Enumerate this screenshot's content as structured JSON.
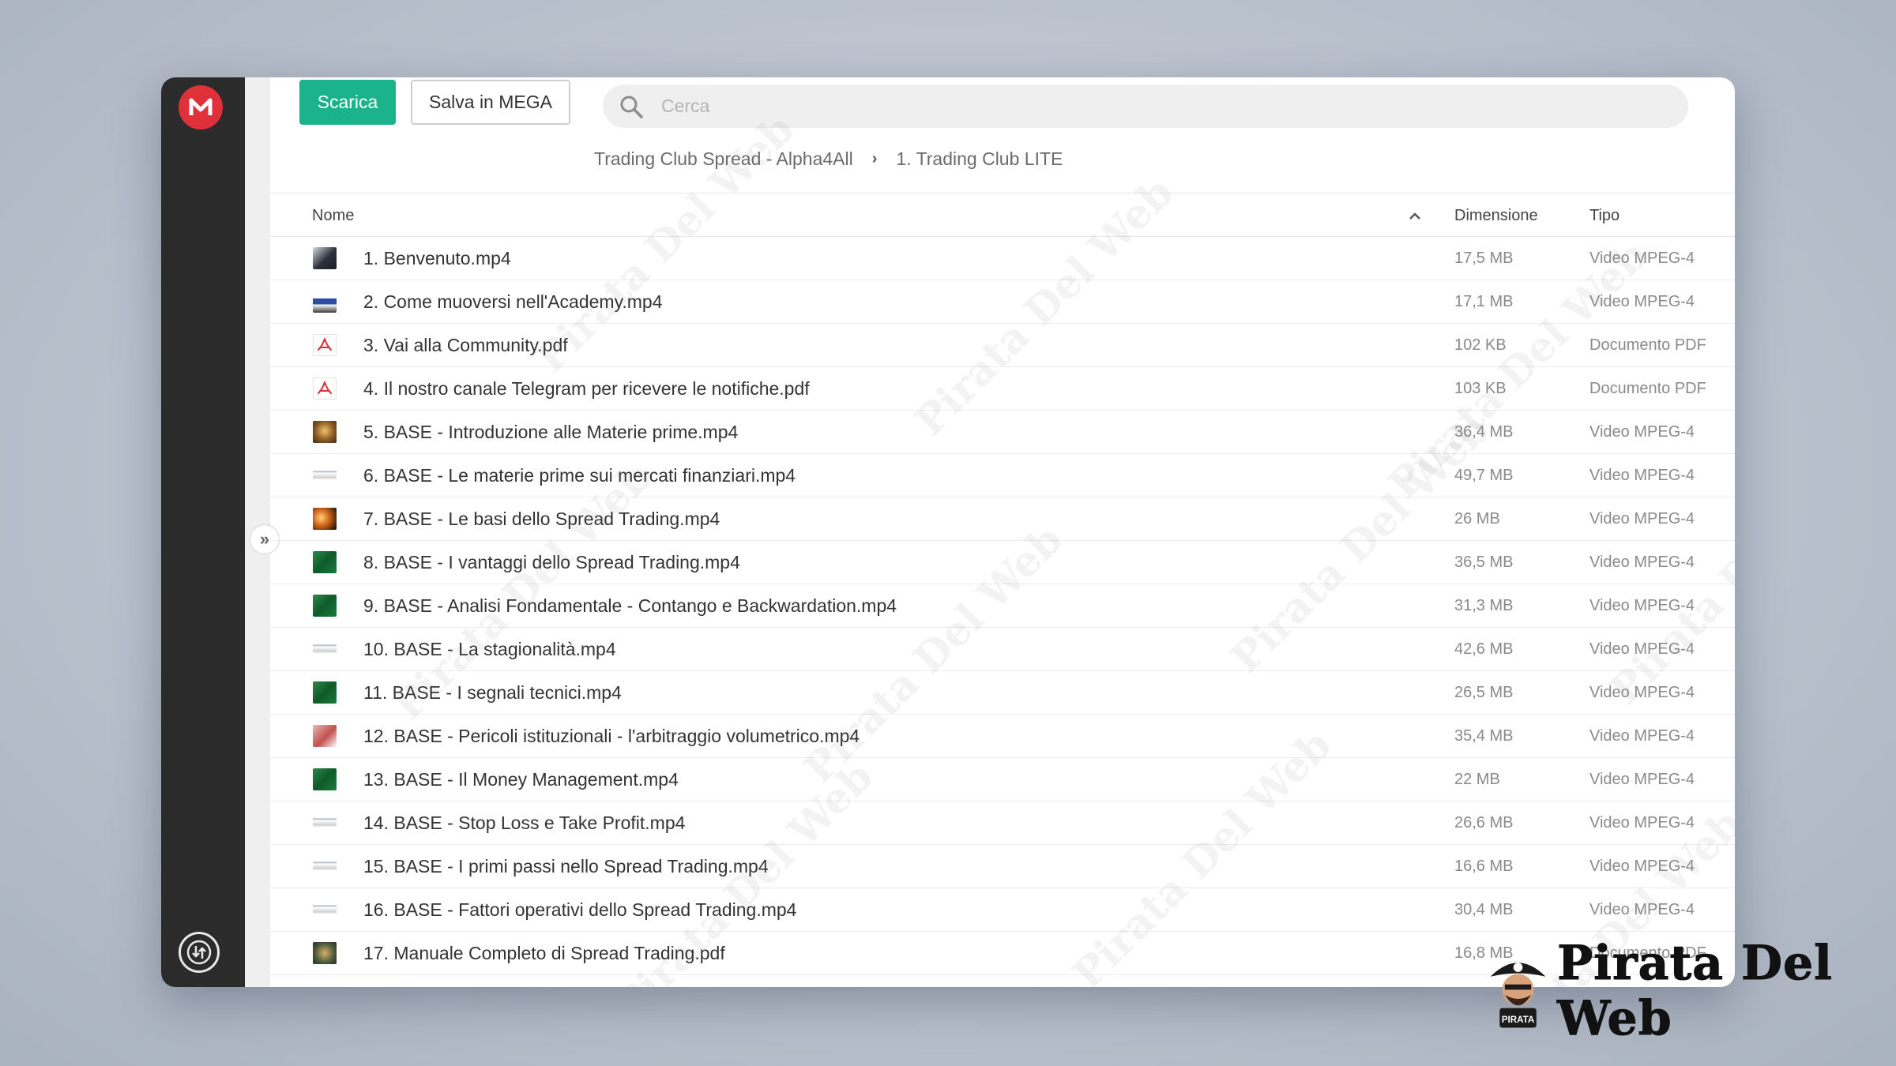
{
  "toolbar": {
    "download_label": "Scarica",
    "save_label": "Salva in MEGA"
  },
  "search": {
    "placeholder": "Cerca",
    "value": ""
  },
  "breadcrumb": {
    "items": [
      "Trading Club Spread - Alpha4All",
      "1. Trading Club LITE"
    ]
  },
  "table": {
    "columns": {
      "name": "Nome",
      "size": "Dimensione",
      "type": "Tipo"
    },
    "sort": "ascending",
    "rows": [
      {
        "name": "1. Benvenuto.mp4",
        "size": "17,5 MB",
        "type": "Video MPEG-4",
        "thumb": "video-person"
      },
      {
        "name": "2. Come muoversi nell'Academy.mp4",
        "size": "17,1 MB",
        "type": "Video MPEG-4",
        "thumb": "video-screen"
      },
      {
        "name": "3. Vai alla Community.pdf",
        "size": "102 KB",
        "type": "Documento PDF",
        "thumb": "pdf"
      },
      {
        "name": "4. Il nostro canale Telegram per ricevere le notifiche.pdf",
        "size": "103 KB",
        "type": "Documento PDF",
        "thumb": "pdf"
      },
      {
        "name": "5. BASE - Introduzione alle Materie prime.mp4",
        "size": "36,4 MB",
        "type": "Video MPEG-4",
        "thumb": "video-gold"
      },
      {
        "name": "6. BASE - Le materie prime sui mercati finanziari.mp4",
        "size": "49,7 MB",
        "type": "Video MPEG-4",
        "thumb": "video-light"
      },
      {
        "name": "7. BASE - Le basi dello Spread Trading.mp4",
        "size": "26 MB",
        "type": "Video MPEG-4",
        "thumb": "video-fire"
      },
      {
        "name": "8. BASE - I vantaggi dello Spread Trading.mp4",
        "size": "36,5 MB",
        "type": "Video MPEG-4",
        "thumb": "video-green"
      },
      {
        "name": "9. BASE - Analisi Fondamentale - Contango e Backwardation.mp4",
        "size": "31,3 MB",
        "type": "Video MPEG-4",
        "thumb": "video-green"
      },
      {
        "name": "10. BASE - La stagionalità.mp4",
        "size": "42,6 MB",
        "type": "Video MPEG-4",
        "thumb": "video-light"
      },
      {
        "name": "11. BASE - I segnali tecnici.mp4",
        "size": "26,5 MB",
        "type": "Video MPEG-4",
        "thumb": "video-green"
      },
      {
        "name": "12. BASE - Pericoli istituzionali - l'arbitraggio volumetrico.mp4",
        "size": "35,4 MB",
        "type": "Video MPEG-4",
        "thumb": "video-red"
      },
      {
        "name": "13. BASE - Il Money Management.mp4",
        "size": "22 MB",
        "type": "Video MPEG-4",
        "thumb": "video-green"
      },
      {
        "name": "14. BASE - Stop Loss e Take Profit.mp4",
        "size": "26,6 MB",
        "type": "Video MPEG-4",
        "thumb": "video-light"
      },
      {
        "name": "15. BASE - I primi passi nello Spread Trading.mp4",
        "size": "16,6 MB",
        "type": "Video MPEG-4",
        "thumb": "video-light"
      },
      {
        "name": "16. BASE - Fattori operativi dello Spread Trading.mp4",
        "size": "30,4 MB",
        "type": "Video MPEG-4",
        "thumb": "video-light"
      },
      {
        "name": "17. Manuale Completo di Spread Trading.pdf",
        "size": "16,8 MB",
        "type": "Documento PDF",
        "thumb": "pdf-cover"
      }
    ]
  },
  "watermark": {
    "text": "Pirata Del Web"
  },
  "brand": {
    "name": "Pirata Del Web",
    "badge": "PIRATA"
  },
  "colors": {
    "accent": "#1ab38b",
    "mega_red": "#e0313b",
    "sidebar": "#2b2b2b"
  }
}
